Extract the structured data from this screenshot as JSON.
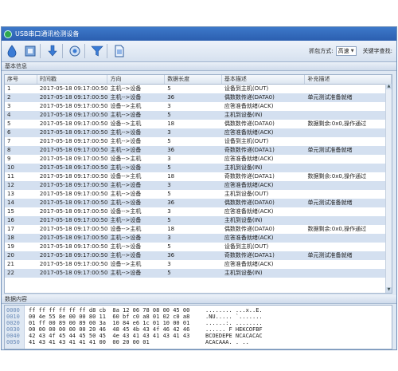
{
  "window": {
    "title": "USB串口通讯检测设备"
  },
  "toolbar": {
    "buttons": [
      "save-icon",
      "stop-icon",
      "download-icon",
      "connect-icon",
      "filter-icon",
      "document-icon"
    ],
    "capture_mode_label": "抓包方式:",
    "capture_mode_value": "高速",
    "keyword_label": "关键字查找:"
  },
  "basic_section": {
    "title": "基本信息"
  },
  "table": {
    "headers": [
      "序号",
      "时间戳",
      "方向",
      "数据长度",
      "基本描述",
      "补充描述"
    ],
    "rows": [
      [
        "1",
        "2017-05-18 09:17:00:503",
        "主机-->设备",
        "5",
        "设备到主机(OUT)",
        ""
      ],
      [
        "2",
        "2017-05-18 09:17:00:503",
        "主机-->设备",
        "36",
        "偶数数传递(DATA0)",
        "单元测试准备就绪"
      ],
      [
        "3",
        "2017-05-18 09:17:00:503",
        "设备-->主机",
        "3",
        "应答准备就绪(ACK)",
        ""
      ],
      [
        "4",
        "2017-05-18 09:17:00:503",
        "主机-->设备",
        "5",
        "主机到设备(IN)",
        ""
      ],
      [
        "5",
        "2017-05-18 09:17:00:503",
        "设备-->主机",
        "18",
        "偶数数传递(DATA0)",
        "数据剩余:0x0,操作通过"
      ],
      [
        "6",
        "2017-05-18 09:17:00:503",
        "主机-->设备",
        "3",
        "应答准备就绪(ACK)",
        ""
      ],
      [
        "7",
        "2017-05-18 09:17:00:503",
        "主机-->设备",
        "5",
        "设备到主机(OUT)",
        ""
      ],
      [
        "8",
        "2017-05-18 09:17:00:503",
        "主机-->设备",
        "36",
        "奇数数传递(DATA1)",
        "单元测试准备就绪"
      ],
      [
        "9",
        "2017-05-18 09:17:00:503",
        "设备-->主机",
        "3",
        "应答准备就绪(ACK)",
        ""
      ],
      [
        "10",
        "2017-05-18 09:17:00:503",
        "主机-->设备",
        "5",
        "主机到设备(IN)",
        ""
      ],
      [
        "11",
        "2017-05-18 09:17:00:503",
        "设备-->主机",
        "18",
        "奇数数传递(DATA1)",
        "数据剩余:0x0,操作通过"
      ],
      [
        "12",
        "2017-05-18 09:17:00:503",
        "主机-->设备",
        "3",
        "应答准备就绪(ACK)",
        ""
      ],
      [
        "13",
        "2017-05-18 09:17:00:503",
        "主机-->设备",
        "5",
        "主机到设备(OUT)",
        ""
      ],
      [
        "14",
        "2017-05-18 09:17:00:503",
        "主机-->设备",
        "36",
        "偶数数传递(DATA0)",
        "单元测试准备就绪"
      ],
      [
        "15",
        "2017-05-18 09:17:00:503",
        "设备-->主机",
        "3",
        "应答准备就绪(ACK)",
        ""
      ],
      [
        "16",
        "2017-05-18 09:17:00:503",
        "主机-->设备",
        "5",
        "主机到设备(IN)",
        ""
      ],
      [
        "17",
        "2017-05-18 09:17:00:503",
        "设备-->主机",
        "18",
        "偶数数传递(DATA0)",
        "数据剩余:0x0,操作通过"
      ],
      [
        "18",
        "2017-05-18 09:17:00:503",
        "主机-->设备",
        "3",
        "应答准备就绪(ACK)",
        ""
      ],
      [
        "19",
        "2017-05-18 09:17:00:503",
        "主机-->设备",
        "5",
        "设备到主机(OUT)",
        ""
      ],
      [
        "20",
        "2017-05-18 09:17:00:503",
        "主机-->设备",
        "36",
        "奇数数传递(DATA1)",
        "单元测试准备就绪"
      ],
      [
        "21",
        "2017-05-18 09:17:00:503",
        "设备-->主机",
        "3",
        "应答准备就绪(ACK)",
        ""
      ],
      [
        "22",
        "2017-05-18 09:17:00:503",
        "主机-->设备",
        "5",
        "主机到设备(IN)",
        ""
      ]
    ]
  },
  "data_section": {
    "title": "数据内容"
  },
  "hex": {
    "lines": [
      {
        "offset": "0000",
        "bytes": "ff ff ff ff ff ff d8 cb  8a 12 06 78 08 00 45 00",
        "ascii": "........ ...x..E."
      },
      {
        "offset": "0010",
        "bytes": "00 4e 55 8e 00 00 80 11  60 bf c0 a8 01 02 c0 a8",
        "ascii": ".NU..... `......."
      },
      {
        "offset": "0020",
        "bytes": "01 ff 00 89 00 89 00 3a  10 84 e6 1c 01 10 00 01",
        "ascii": "......:. ........"
      },
      {
        "offset": "0030",
        "bytes": "00 00 00 00 00 00 20 46  48 45 4b 43 4f 46 42 46",
        "ascii": "...... F HEKCOFBF"
      },
      {
        "offset": "0040",
        "bytes": "42 43 4f 45 44 45 50 45  4e 43 41 43 41 43 41 43",
        "ascii": "BCOEDEPE NCACACAC"
      },
      {
        "offset": "0050",
        "bytes": "41 43 41 43 41 41 41 00  00 20 00 01",
        "ascii": "ACACAAA. . .."
      }
    ]
  }
}
